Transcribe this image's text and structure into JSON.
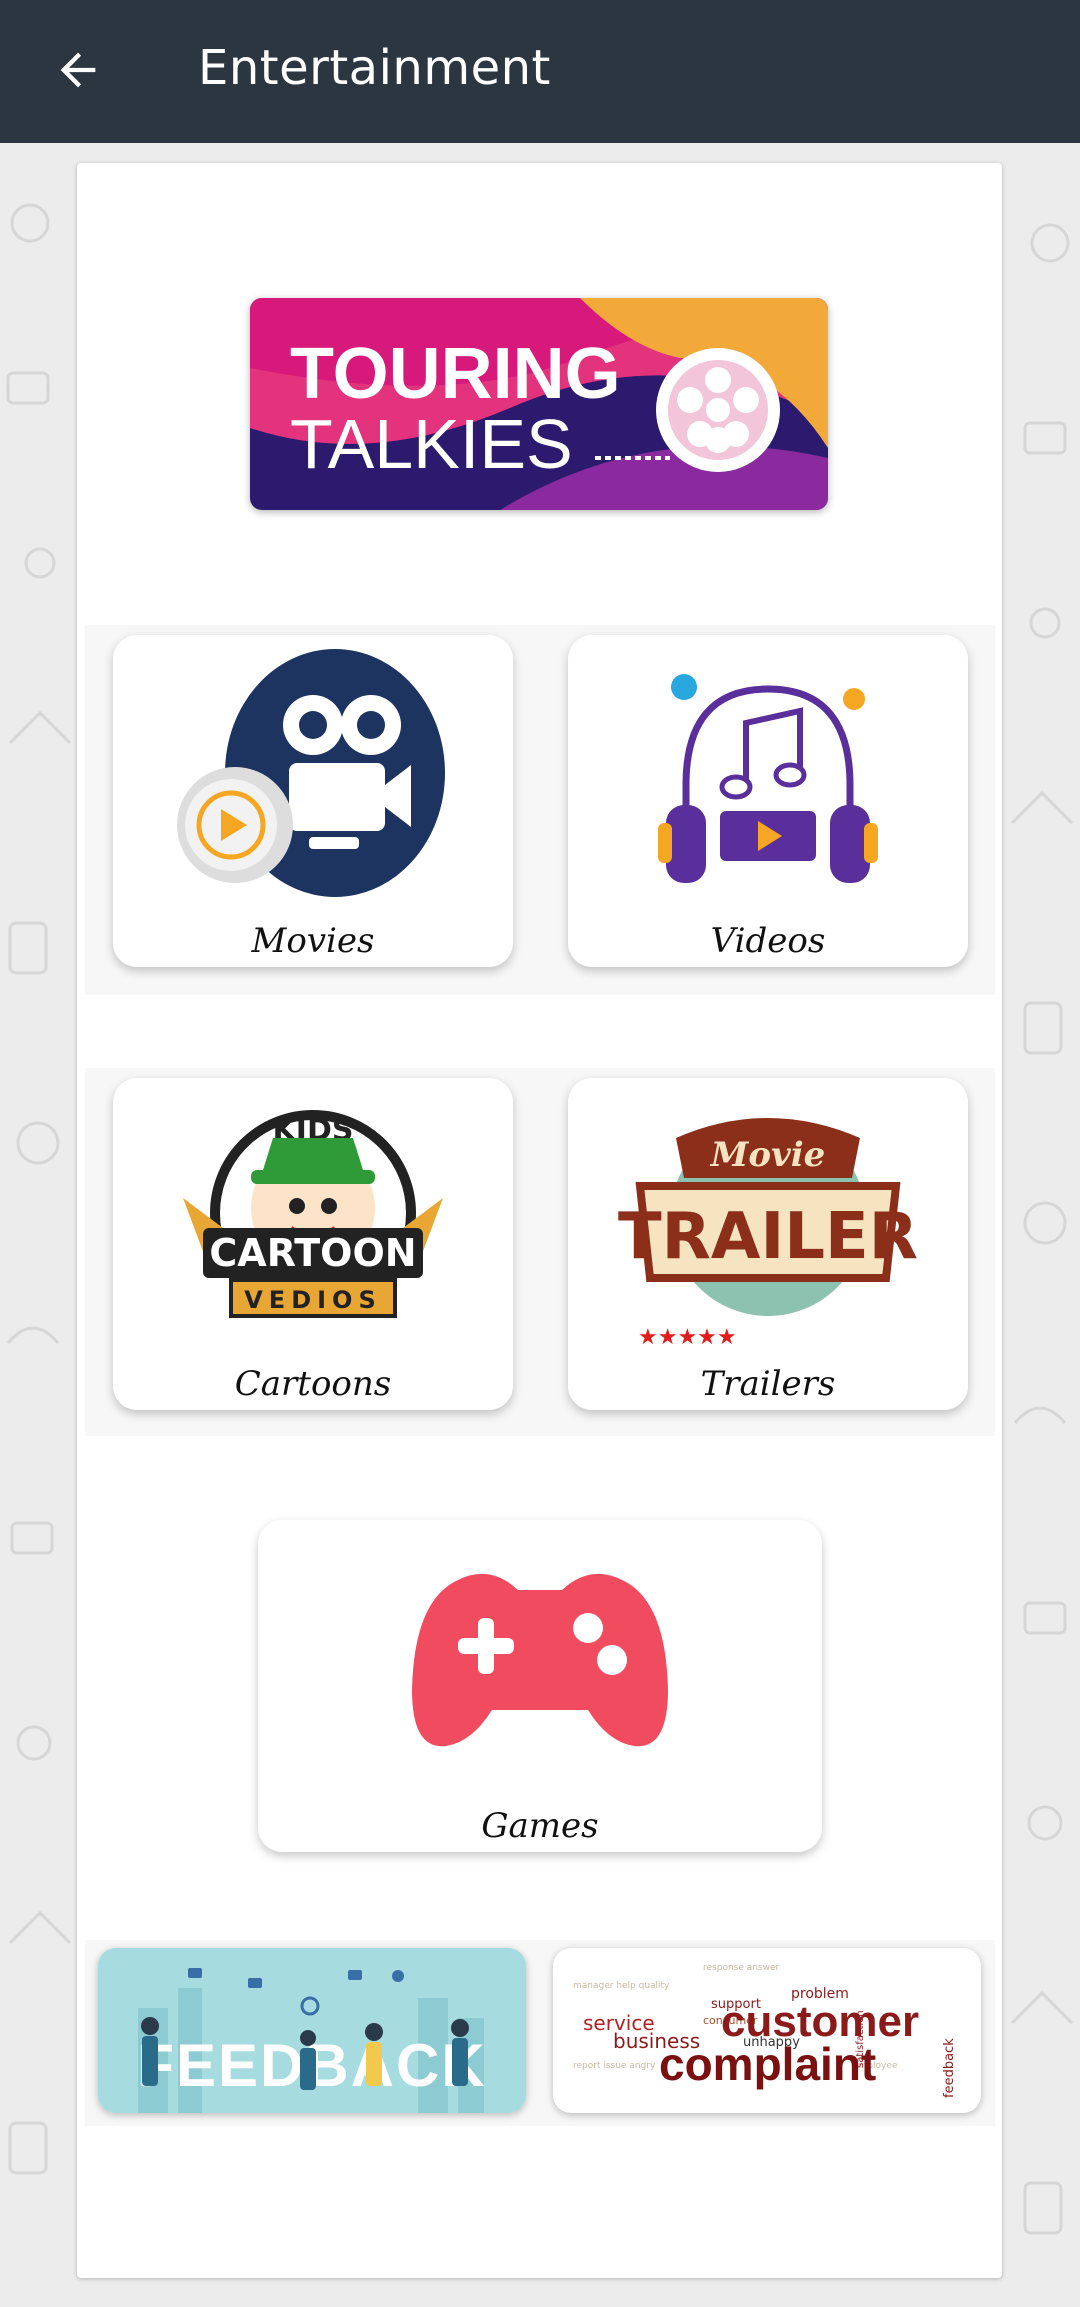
{
  "header": {
    "title": "Entertainment"
  },
  "banner": {
    "line1": "TOURING",
    "line2": "TALKIES"
  },
  "tiles": [
    {
      "label": "Movies"
    },
    {
      "label": "Videos"
    },
    {
      "label": "Cartoons"
    },
    {
      "label": "Trailers"
    },
    {
      "label": "Games"
    }
  ],
  "art_text": {
    "cartoon_kids": "KIDS",
    "cartoon_main": "CARTOON",
    "cartoon_sub": "VEDIOS",
    "trailer_top": "Movie",
    "trailer_main": "TRAILER"
  },
  "promos": {
    "feedback": {
      "text": "FEEDBACK"
    },
    "complaint": {
      "words": [
        "customer",
        "complaint",
        "service",
        "business",
        "support",
        "problem",
        "consumer",
        "unhappy",
        "feedback",
        "satisfaction"
      ]
    }
  },
  "colors": {
    "appbar": "#2c3641",
    "banner_magenta": "#d6197a",
    "banner_navy": "#2b1a6e",
    "banner_orange": "#f3a93a",
    "movies_navy": "#1d3461",
    "videos_purple": "#5b2f9b",
    "games_red": "#f04b5f"
  }
}
